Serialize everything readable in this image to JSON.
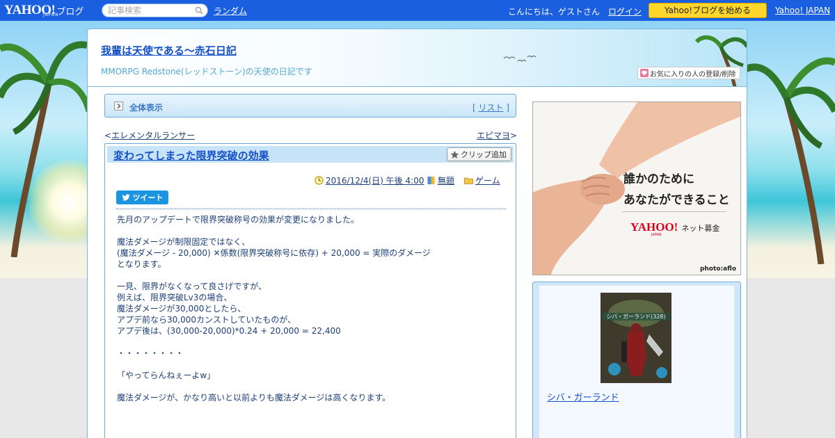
{
  "topbar": {
    "logo_main": "YAHOO!",
    "logo_sub": "JAPAN",
    "logo_blog": "ブログ",
    "search_placeholder": "記事検索",
    "random_label": "ランダム",
    "greeting": "こんにちは、ゲストさん",
    "login_label": "ログイン",
    "start_blog_label": "Yahoo!ブログを始める",
    "yahoo_japan_label": "Yahoo! JAPAN"
  },
  "header": {
    "blog_title": "我輩は天使である～赤石日記",
    "blog_description": "MMORPG Redstone(レッドストーン)の天使の日記です",
    "favorite_label": "お気に入りの人の登録/削除"
  },
  "all_view": {
    "label": "全体表示",
    "list_open": "[ ",
    "list_label": "リスト",
    "list_close": " ]"
  },
  "nav": {
    "prev_prefix": "<",
    "prev_label": "エレメンタルランサー",
    "next_label": "エピマヨ",
    "next_suffix": ">"
  },
  "article": {
    "title": "変わってしまった限界突破の効果",
    "clip_label": "クリップ追加",
    "date": "2016/12/4(日) 午後 4:00",
    "theme": "無題",
    "category": "ゲーム",
    "tweet_label": "ツイート",
    "body": [
      "先月のアップデートで限界突破称号の効果が変更になりました。",
      "",
      "魔法ダメージが制限固定ではなく、",
      "(魔法ダメージ - 20,000) ✕係数(限界突破称号に依存) + 20,000 = 実際のダメージ",
      "となります。",
      "",
      "一見、限界がなくなって良さげですが、",
      "例えば、限界突破Lv3の場合、",
      "魔法ダメージが30,000としたら、",
      "アプデ前なら30,000カンストしていたものが、",
      "アプデ後は、(30,000-20,000)*0.24 + 20,000 = 22,400",
      "",
      "・・・・・・・・",
      "",
      "「やってらんねぇーよw」",
      "",
      "魔法ダメージが、かなり高いと以前よりも魔法ダメージは高くなります。"
    ]
  },
  "ad": {
    "line1": "誰かのために",
    "line2": "あなたができること",
    "brand": "YAHOO!",
    "brand_sub": "JAPAN",
    "cause": "ネット募金",
    "credit": "photo:aflo"
  },
  "profile": {
    "image_tag": "シバ・ガーランド(328)",
    "name": "シバ・ガーランド"
  },
  "colors": {
    "topbar": "#1a5fe0",
    "start_button": "#ffd72a",
    "title_link": "#1450c8",
    "text": "#1c3f78",
    "panel": "#c6e3f8",
    "tweet": "#1b95e0"
  }
}
